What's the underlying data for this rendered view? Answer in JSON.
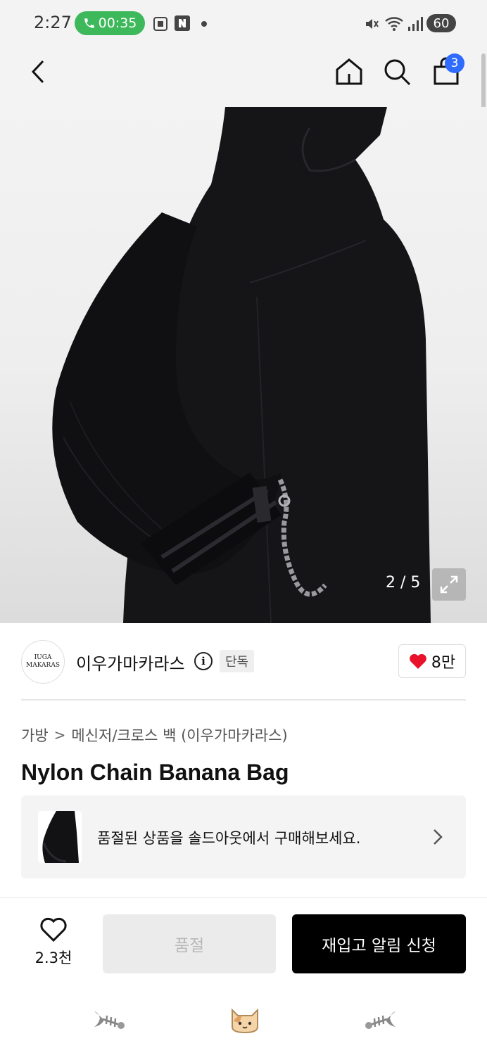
{
  "status_bar": {
    "time": "2:27",
    "call_timer": "00:35",
    "battery": "60"
  },
  "nav": {
    "cart_count": "3"
  },
  "gallery": {
    "counter": "2 / 5"
  },
  "brand": {
    "logo_line1": "IUGA",
    "logo_line2": "MAKARAS",
    "name": "이우가마카라스",
    "info_label": "i",
    "badge": "단독",
    "likes": "8만"
  },
  "breadcrumb": {
    "category": "가방",
    "separator": ">",
    "subcategory": "메신저/크로스 백 (이우가마카라스)"
  },
  "product": {
    "title": "Nylon Chain Banana Bag"
  },
  "soldout_banner": {
    "text": "품절된 상품을 솔드아웃에서 구매해보세요."
  },
  "action_bar": {
    "wish_count": "2.3천",
    "soldout_label": "품절",
    "restock_label": "재입고 알림 신청"
  },
  "colors": {
    "accent_blue": "#2f6bff",
    "call_green": "#3db85a",
    "heart_red": "#e8122b",
    "primary_black": "#000000"
  }
}
